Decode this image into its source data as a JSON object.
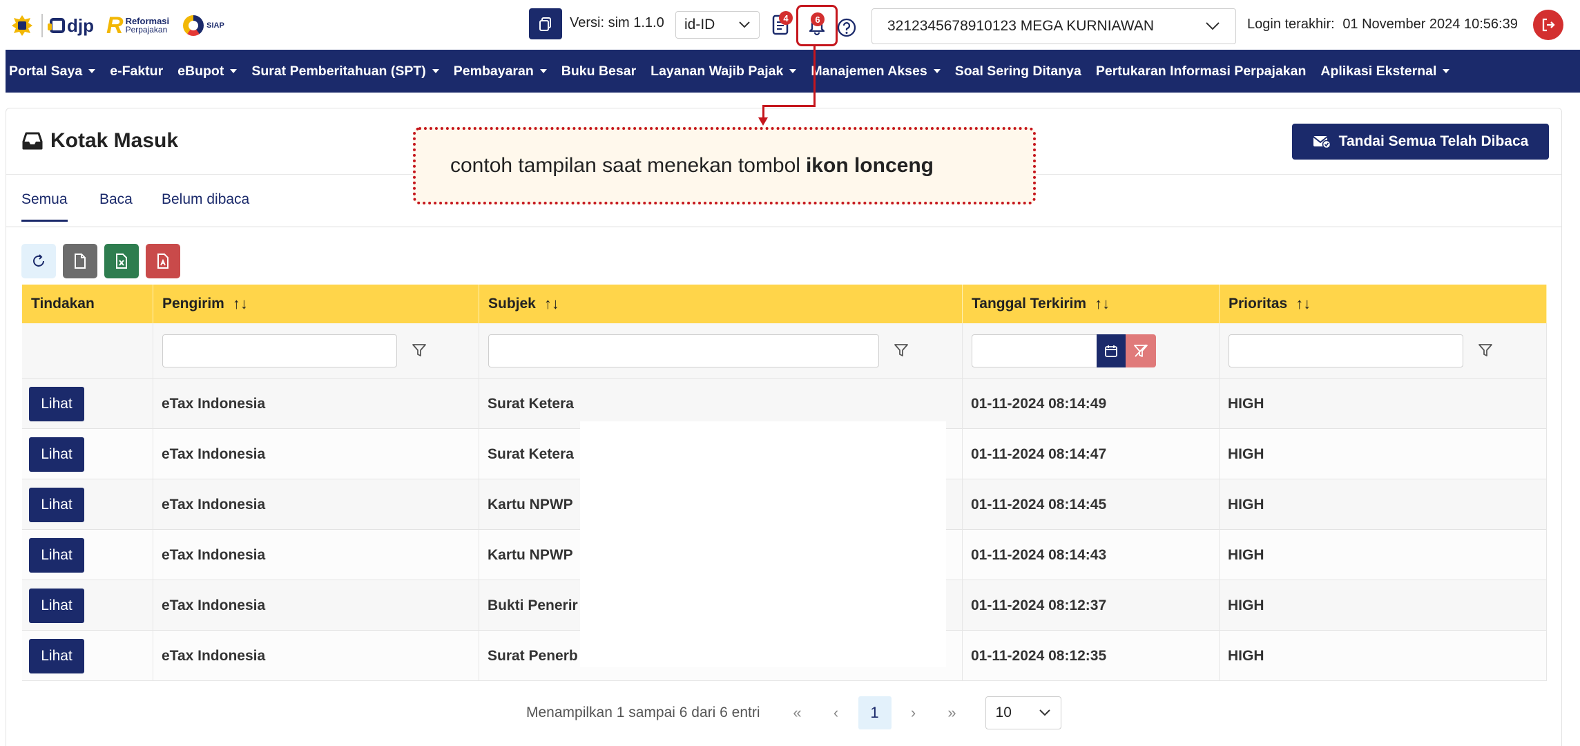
{
  "header": {
    "logo_reformasi_line1": "Reformasi",
    "logo_reformasi_line2": "Perpajakan",
    "logo_siap": "SIAP",
    "logo_djp": "djp",
    "version_label": "Versi:  sim 1.1.0",
    "language": "id-ID",
    "doc_badge": "4",
    "bell_badge": "6",
    "user": "3212345678910123 MEGA KURNIAWAN",
    "login_label": "Login terakhir:",
    "login_value": "01 November 2024 10:56:39"
  },
  "nav": [
    {
      "label": "Portal Saya",
      "caret": true
    },
    {
      "label": "e-Faktur",
      "caret": false
    },
    {
      "label": "eBupot",
      "caret": true
    },
    {
      "label": "Surat Pemberitahuan (SPT)",
      "caret": true
    },
    {
      "label": "Pembayaran",
      "caret": true
    },
    {
      "label": "Buku Besar",
      "caret": false
    },
    {
      "label": "Layanan Wajib Pajak",
      "caret": true
    },
    {
      "label": "Manajemen Akses",
      "caret": true
    },
    {
      "label": "Soal Sering Ditanya",
      "caret": false
    },
    {
      "label": "Pertukaran Informasi Perpajakan",
      "caret": false
    },
    {
      "label": "Aplikasi Eksternal",
      "caret": true
    }
  ],
  "page": {
    "title": "Kotak Masuk",
    "mark_all_label": "Tandai Semua Telah Dibaca",
    "tabs": [
      "Semua",
      "Baca",
      "Belum dibaca"
    ]
  },
  "table": {
    "headers": [
      "Tindakan",
      "Pengirim",
      "Subjek",
      "Tanggal Terkirim",
      "Prioritas"
    ],
    "sort_glyph": "↑↓",
    "action_label": "Lihat",
    "rows": [
      {
        "sender": "eTax Indonesia",
        "subject": "Surat Ketera",
        "date": "01-11-2024 08:14:49",
        "priority": "HIGH"
      },
      {
        "sender": "eTax Indonesia",
        "subject": "Surat Ketera",
        "date": "01-11-2024 08:14:47",
        "priority": "HIGH"
      },
      {
        "sender": "eTax Indonesia",
        "subject": "Kartu NPWP",
        "date": "01-11-2024 08:14:45",
        "priority": "HIGH"
      },
      {
        "sender": "eTax Indonesia",
        "subject": "Kartu NPWP",
        "date": "01-11-2024 08:14:43",
        "priority": "HIGH"
      },
      {
        "sender": "eTax Indonesia",
        "subject": "Bukti Penerir",
        "date": "01-11-2024 08:12:37",
        "priority": "HIGH"
      },
      {
        "sender": "eTax Indonesia",
        "subject": "Surat Penerb",
        "date": "01-11-2024 08:12:35",
        "priority": "HIGH"
      }
    ]
  },
  "pagination": {
    "info": "Menampilkan 1 sampai 6 dari 6 entri",
    "first": "«",
    "prev": "‹",
    "current": "1",
    "next": "›",
    "last": "»",
    "per_page": "10"
  },
  "annotation": {
    "text": "contoh tampilan saat menekan tombol",
    "bold": "ikon lonceng"
  },
  "colors": {
    "primary": "#1b2a6b",
    "header_yellow": "#ffd54a",
    "danger": "#d32f2f",
    "annotation_red": "#c5161d"
  }
}
